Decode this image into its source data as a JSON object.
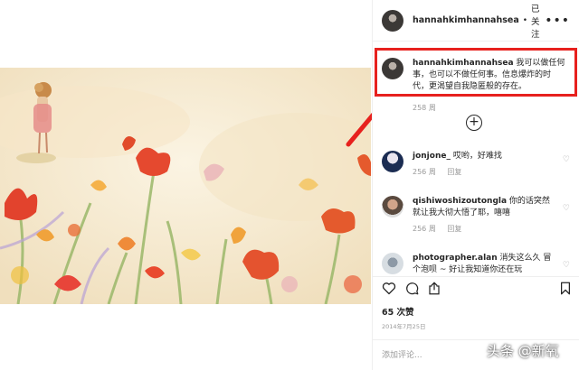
{
  "post": {
    "username": "hannahkimhannahsea",
    "dot": "•",
    "follow_status": "已关注",
    "more_icon": "more-horizontal-icon"
  },
  "caption": {
    "username": "hannahkimhannahsea",
    "text": "我可以做任何事，也可以不做任何事。信息爆炸的时代，更渴望自我隐匿般的存在。",
    "time": "258 周"
  },
  "comments": [
    {
      "username": "jonjone_",
      "text": "哎哟，好难找",
      "time": "256 周",
      "reply": "回复"
    },
    {
      "username": "qishiwoshizoutongla",
      "text": "你的话突然就让我大彻大悟了耶，嘻嘻",
      "time": "256 周",
      "reply": "回复"
    },
    {
      "username": "photographer.alan",
      "text": "消失这么久 冒个泡呗 ~ 好让我知道你还在玩",
      "time": "",
      "reply": ""
    }
  ],
  "actions": {
    "like_icon": "heart-icon",
    "comment_icon": "comment-icon",
    "share_icon": "share-icon",
    "save_icon": "bookmark-icon"
  },
  "likes": "65 次赞",
  "date": "2014年7月25日",
  "add_comment_placeholder": "添加评论...",
  "watermark": "头条 @新氧",
  "colors": {
    "highlight": "#e7211e",
    "text": "#262626",
    "muted": "#999999"
  }
}
